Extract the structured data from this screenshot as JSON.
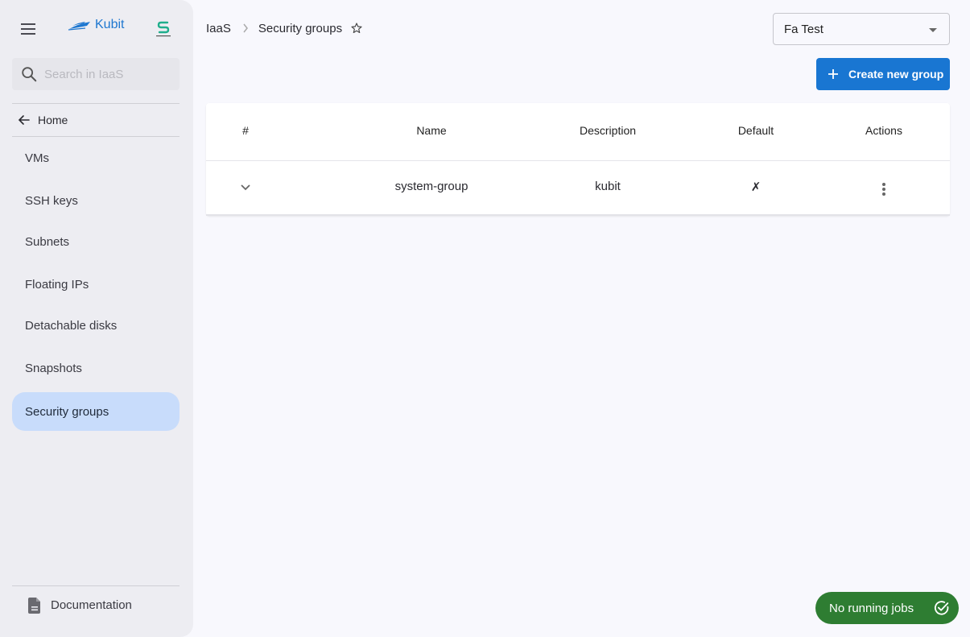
{
  "sidebar": {
    "brand": "Kubit",
    "search_placeholder": "Search in IaaS",
    "search_value": "",
    "home_label": "Home",
    "items": [
      {
        "label": "VMs",
        "active": false
      },
      {
        "label": "SSH keys",
        "active": false
      },
      {
        "label": "Subnets",
        "active": false
      },
      {
        "label": "Floating IPs",
        "active": false
      },
      {
        "label": "Detachable disks",
        "active": false
      },
      {
        "label": "Snapshots",
        "active": false
      },
      {
        "label": "Security groups",
        "active": true
      }
    ],
    "documentation_label": "Documentation",
    "icons": {
      "menu": "hamburger-menu-icon",
      "search": "search-icon",
      "home": "arrow-left-icon",
      "documentation": "document-icon"
    }
  },
  "header": {
    "breadcrumb": [
      "IaaS",
      "Security groups"
    ],
    "favorite_icon": "star-outline-icon",
    "project_select": {
      "value": "Fa Test"
    },
    "create_button_label": "Create new group"
  },
  "table": {
    "columns": [
      "#",
      "Name",
      "Description",
      "Default",
      "Actions"
    ],
    "rows": [
      {
        "name": "system-group",
        "description": "kubit",
        "default": "✗"
      }
    ]
  },
  "jobs": {
    "label": "No running jobs",
    "status": "idle"
  },
  "colors": {
    "accent": "#1976d2",
    "active_nav": "#c8dcfb",
    "jobs_ok": "#2e7d32",
    "brand": "#1e77d0"
  }
}
